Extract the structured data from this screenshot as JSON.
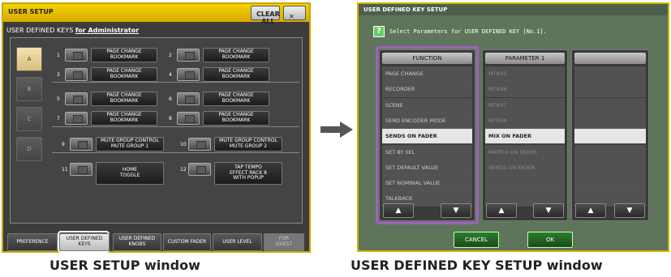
{
  "user_setup": {
    "title": "USER SETUP",
    "clear_all": "CLEAR ALL",
    "close": "✕",
    "subtitle": "USER DEFINED KEYS",
    "user": "for Administrator",
    "banks": [
      "A",
      "B",
      "C",
      "D"
    ],
    "keys": [
      {
        "n": "1",
        "label": "PAGE CHANGE\nBOOKMARK"
      },
      {
        "n": "2",
        "label": "PAGE CHANGE\nBOOKMARK"
      },
      {
        "n": "3",
        "label": "PAGE CHANGE\nBOOKMARK"
      },
      {
        "n": "4",
        "label": "PAGE CHANGE\nBOOKMARK"
      },
      {
        "n": "5",
        "label": "PAGE CHANGE\nBOOKMARK"
      },
      {
        "n": "6",
        "label": "PAGE CHANGE\nBOOKMARK"
      },
      {
        "n": "7",
        "label": "PAGE CHANGE\nBOOKMARK"
      },
      {
        "n": "8",
        "label": "PAGE CHANGE\nBOOKMARK"
      },
      {
        "n": "9",
        "label": "MUTE GROUP CONTROL\nMUTE GROUP 1"
      },
      {
        "n": "10",
        "label": "MUTE GROUP CONTROL\nMUTE GROUP 2"
      },
      {
        "n": "11",
        "label": "HOME\nTOGGLE"
      },
      {
        "n": "12",
        "label": "TAP TEMPO\nEFFECT RACK 8\nWITH POPUP"
      }
    ],
    "tabs": [
      "PREFERENCE",
      "USER DEFINED\nKEYS",
      "USER DEFINED\nKNOBS",
      "CUSTOM FADER",
      "USER LEVEL",
      "FOR\nGUEST"
    ]
  },
  "key_setup": {
    "title": "USER DEFINED KEY SETUP",
    "help": "?",
    "prompt": "Select Parameters for USER DEFINED KEY [No.1].",
    "function_header": "FUNCTION",
    "param1_header": "PARAMETER 1",
    "functions": [
      "PAGE CHANGE",
      "RECORDER",
      "SCENE",
      "SEND ENCODER MODE",
      "SENDS ON FADER",
      "SET BY SEL",
      "SET DEFAULT VALUE",
      "SET NOMINAL VALUE",
      "TALKBACK"
    ],
    "params": [
      "MTRX5",
      "MTRX6",
      "MTRX7",
      "MTRX8",
      "MIX ON FADER",
      "MATRIX ON FADER",
      "SENDS ON FADER",
      "",
      ""
    ],
    "up": "▲",
    "down": "▼",
    "cancel": "CANCEL",
    "ok": "OK"
  },
  "captions": {
    "left": "USER SETUP window",
    "right": "USER DEFINED KEY SETUP window"
  },
  "colors": {
    "title_bar": "#f0c800",
    "highlight": "#e6e6e6",
    "purple_frame": "#a060c0"
  }
}
